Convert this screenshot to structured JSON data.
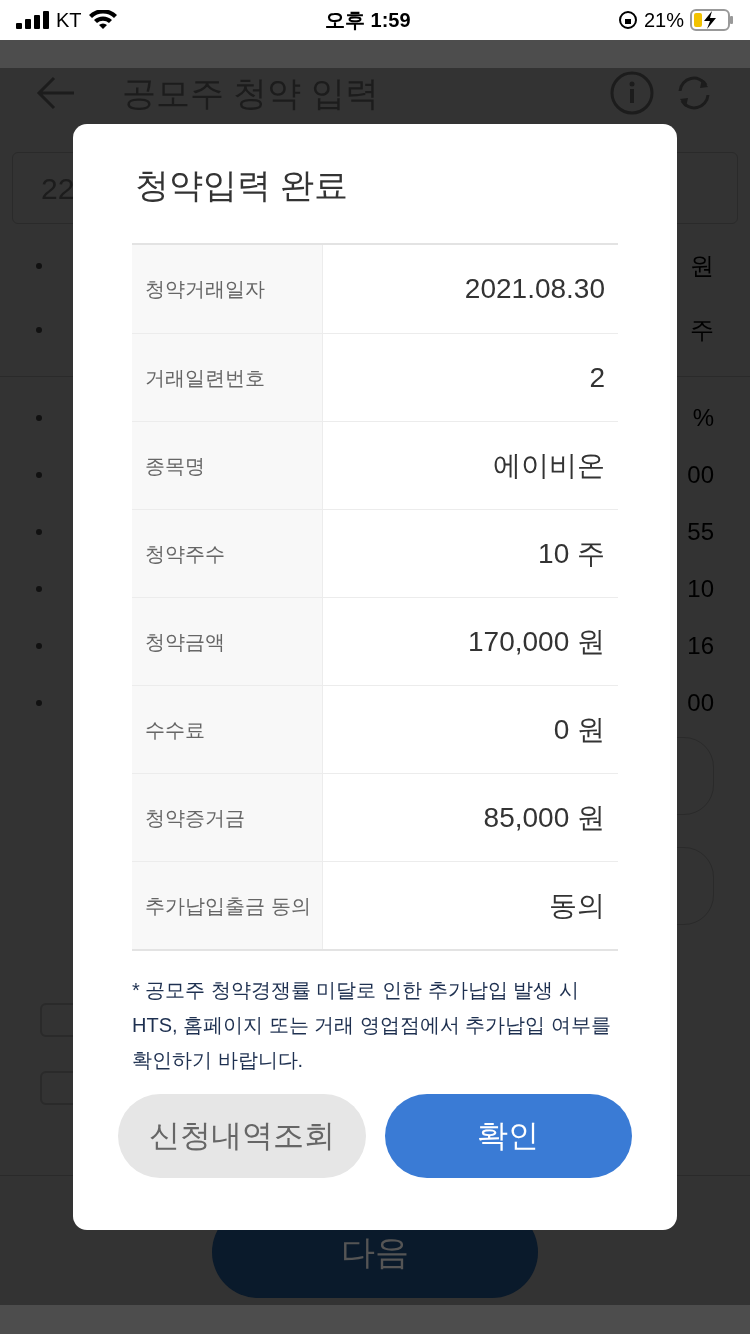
{
  "status_bar": {
    "carrier": "KT",
    "time": "오후 1:59",
    "battery": "21%"
  },
  "header": {
    "title": "공모주 청약 입력"
  },
  "background": {
    "input_value": "22",
    "summary_rows": [
      {
        "value": "원"
      },
      {
        "value": "주"
      }
    ],
    "detail_rows": [
      {
        "value": "%"
      },
      {
        "value": "00"
      },
      {
        "value": "55"
      },
      {
        "value": "10"
      },
      {
        "value": "16"
      },
      {
        "value": "00"
      }
    ],
    "checkboxes": [
      {
        "checked": false
      },
      {
        "checked": false
      }
    ],
    "next_button": "다음"
  },
  "dialog": {
    "title": "청약입력 완료",
    "rows": [
      {
        "label": "청약거래일자",
        "value": "2021.08.30"
      },
      {
        "label": "거래일련번호",
        "value": "2"
      },
      {
        "label": "종목명",
        "value": "에이비온"
      },
      {
        "label": "청약주수",
        "value": "10 주"
      },
      {
        "label": "청약금액",
        "value": "170,000 원"
      },
      {
        "label": "수수료",
        "value": "0 원"
      },
      {
        "label": "청약증거금",
        "value": "85,000 원"
      },
      {
        "label": "추가납입출금 동의",
        "value": "동의"
      }
    ],
    "note": "* 공모주 청약경쟁률 미달로 인한 추가납입 발생 시 HTS, 홈페이지 또는 거래 영업점에서 추가납입 여부를 확인하기 바랍니다.",
    "buttons": [
      {
        "label": "신청내역조회",
        "kind": "secondary"
      },
      {
        "label": "확인",
        "kind": "primary"
      }
    ]
  }
}
